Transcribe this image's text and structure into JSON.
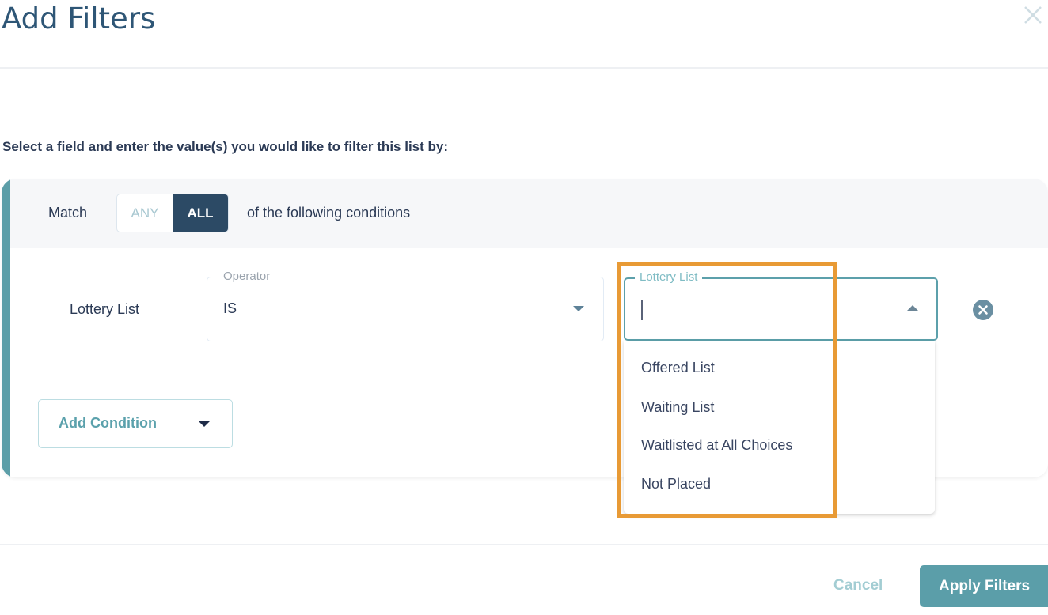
{
  "dialog": {
    "title": "Add Filters",
    "close_icon": "close-x-icon",
    "instructions": "Select a field and enter the value(s) you would like to filter this list by:"
  },
  "match": {
    "label": "Match",
    "options": [
      {
        "label": "ANY",
        "selected": false
      },
      {
        "label": "ALL",
        "selected": true
      }
    ],
    "suffix": "of the following conditions"
  },
  "condition": {
    "field_label": "Lottery List",
    "operator": {
      "legend": "Operator",
      "value": "IS",
      "icon": "caret-down-icon"
    },
    "value_field": {
      "legend": "Lottery List",
      "value": "",
      "icon": "caret-up-icon",
      "dropdown_open": true,
      "options": [
        "Offered List",
        "Waiting List",
        "Waitlisted at All Choices",
        "Not Placed"
      ]
    },
    "remove_icon": "remove-circle-x-icon"
  },
  "add_condition": {
    "label": "Add Condition",
    "icon": "caret-down-icon"
  },
  "footer": {
    "cancel_label": "Cancel",
    "apply_label": "Apply Filters"
  },
  "colors": {
    "primary_teal": "#5b9ea9",
    "dark_navy": "#2c4a65",
    "highlight_orange": "#e89a35",
    "title_blue": "#2e5676"
  }
}
